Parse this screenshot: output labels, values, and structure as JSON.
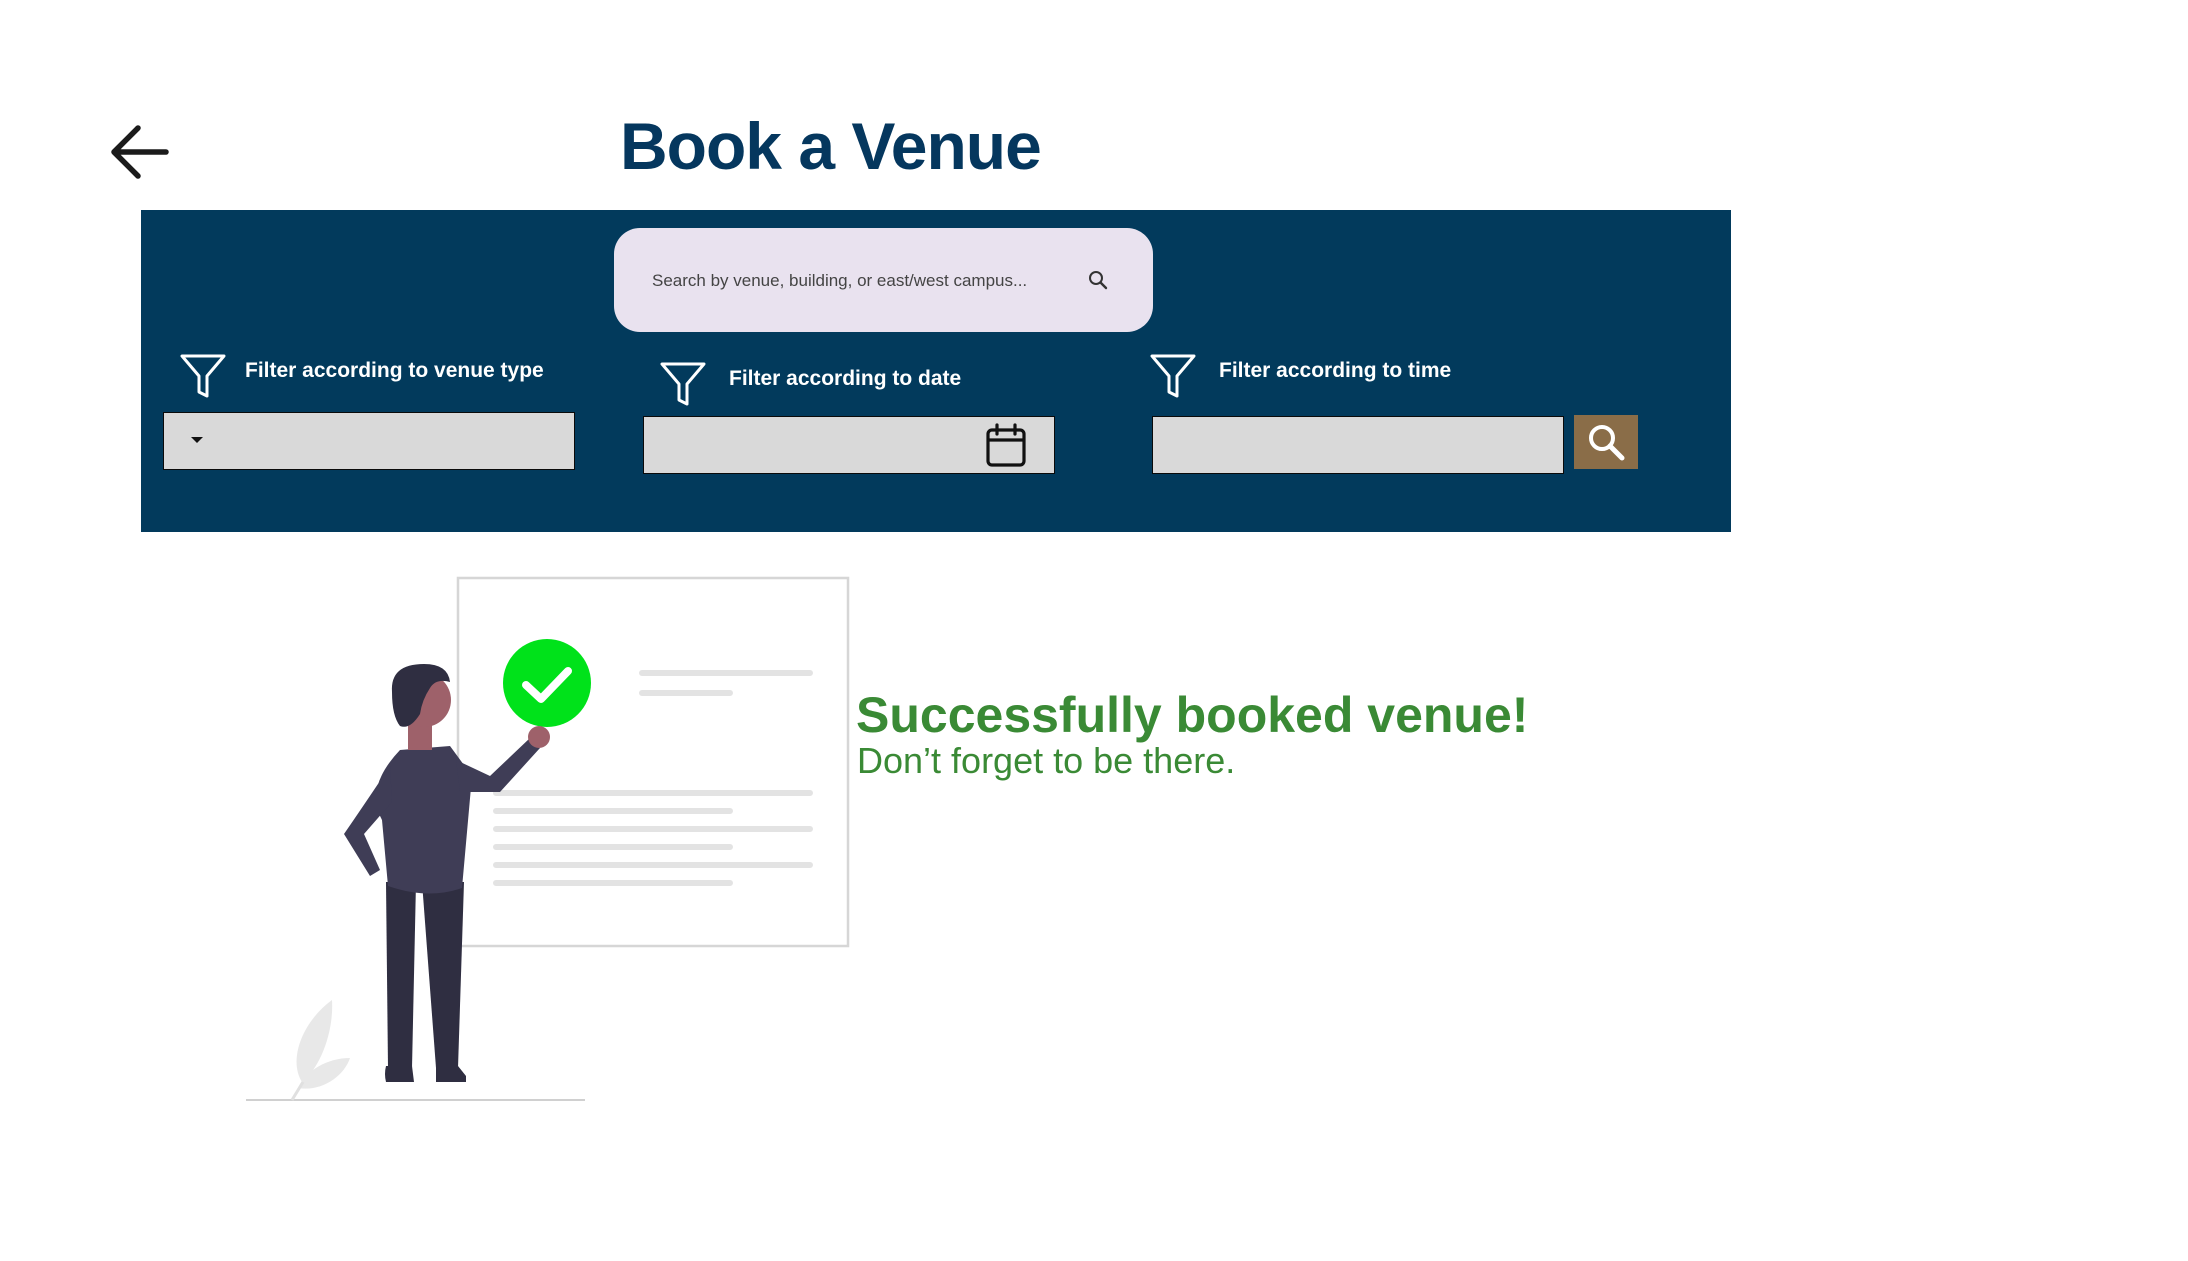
{
  "header": {
    "title": "Book a Venue"
  },
  "search": {
    "placeholder": "Search by venue, building, or east/west campus..."
  },
  "filters": {
    "venue_type_label": "Filter according to venue type",
    "date_label": "Filter according to date",
    "time_label": "Filter according to time"
  },
  "confirmation": {
    "title": "Successfully booked venue!",
    "subtitle": "Don’t forget to be there."
  },
  "colors": {
    "title": "#05375e",
    "panel": "#023a5c",
    "search_bar": "#e9e2ef",
    "field": "#d9d9d9",
    "search_button": "#8a6d48",
    "success_text": "#3a8a35",
    "checkmark_badge": "#00e21a"
  },
  "icons": {
    "back": "arrow-left-icon",
    "search": "magnifier-icon",
    "filter": "funnel-icon",
    "calendar": "calendar-icon",
    "dropdown": "caret-down-icon"
  }
}
